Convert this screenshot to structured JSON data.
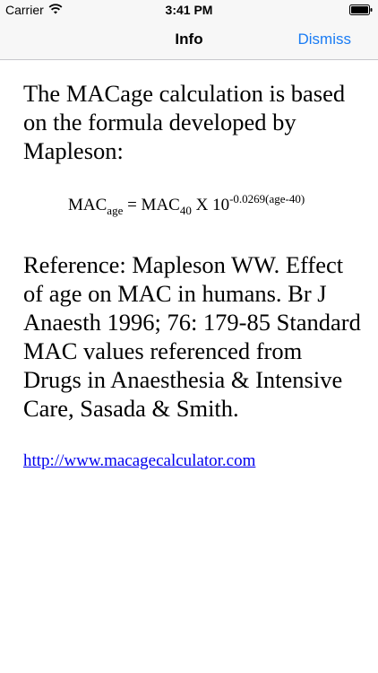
{
  "status_bar": {
    "carrier": "Carrier",
    "time": "3:41 PM",
    "wifi_icon": "wifi-icon",
    "battery_icon": "battery-icon"
  },
  "nav": {
    "title": "Info",
    "dismiss_label": "Dismiss",
    "accent_color": "#1a7cf4"
  },
  "content": {
    "intro": "The MACage calculation is based on the formula developed by Mapleson:",
    "formula": {
      "lhs": "MAC",
      "lhs_sub": "age",
      "equals": " = MAC",
      "rhs_sub": "40",
      "multiplier": " X 10",
      "exponent": "-0.0269(age-40)"
    },
    "reference": "Reference: Mapleson WW. Effect of age on MAC in humans. Br J Anaesth 1996; 76: 179-85 Standard MAC values referenced from Drugs in Anaesthesia & Intensive Care, Sasada & Smith.",
    "link": "http://www.macagecalculator.com"
  }
}
